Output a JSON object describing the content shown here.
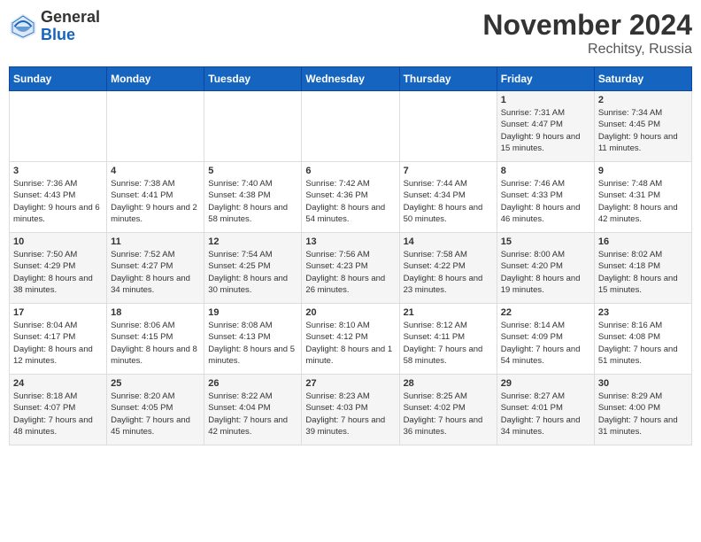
{
  "header": {
    "logo": {
      "general": "General",
      "blue": "Blue"
    },
    "title": "November 2024",
    "location": "Rechitsy, Russia"
  },
  "weekdays": [
    "Sunday",
    "Monday",
    "Tuesday",
    "Wednesday",
    "Thursday",
    "Friday",
    "Saturday"
  ],
  "weeks": [
    [
      null,
      null,
      null,
      null,
      null,
      {
        "day": "1",
        "sunrise": "Sunrise: 7:31 AM",
        "sunset": "Sunset: 4:47 PM",
        "daylight": "Daylight: 9 hours and 15 minutes."
      },
      {
        "day": "2",
        "sunrise": "Sunrise: 7:34 AM",
        "sunset": "Sunset: 4:45 PM",
        "daylight": "Daylight: 9 hours and 11 minutes."
      }
    ],
    [
      {
        "day": "3",
        "sunrise": "Sunrise: 7:36 AM",
        "sunset": "Sunset: 4:43 PM",
        "daylight": "Daylight: 9 hours and 6 minutes."
      },
      {
        "day": "4",
        "sunrise": "Sunrise: 7:38 AM",
        "sunset": "Sunset: 4:41 PM",
        "daylight": "Daylight: 9 hours and 2 minutes."
      },
      {
        "day": "5",
        "sunrise": "Sunrise: 7:40 AM",
        "sunset": "Sunset: 4:38 PM",
        "daylight": "Daylight: 8 hours and 58 minutes."
      },
      {
        "day": "6",
        "sunrise": "Sunrise: 7:42 AM",
        "sunset": "Sunset: 4:36 PM",
        "daylight": "Daylight: 8 hours and 54 minutes."
      },
      {
        "day": "7",
        "sunrise": "Sunrise: 7:44 AM",
        "sunset": "Sunset: 4:34 PM",
        "daylight": "Daylight: 8 hours and 50 minutes."
      },
      {
        "day": "8",
        "sunrise": "Sunrise: 7:46 AM",
        "sunset": "Sunset: 4:33 PM",
        "daylight": "Daylight: 8 hours and 46 minutes."
      },
      {
        "day": "9",
        "sunrise": "Sunrise: 7:48 AM",
        "sunset": "Sunset: 4:31 PM",
        "daylight": "Daylight: 8 hours and 42 minutes."
      }
    ],
    [
      {
        "day": "10",
        "sunrise": "Sunrise: 7:50 AM",
        "sunset": "Sunset: 4:29 PM",
        "daylight": "Daylight: 8 hours and 38 minutes."
      },
      {
        "day": "11",
        "sunrise": "Sunrise: 7:52 AM",
        "sunset": "Sunset: 4:27 PM",
        "daylight": "Daylight: 8 hours and 34 minutes."
      },
      {
        "day": "12",
        "sunrise": "Sunrise: 7:54 AM",
        "sunset": "Sunset: 4:25 PM",
        "daylight": "Daylight: 8 hours and 30 minutes."
      },
      {
        "day": "13",
        "sunrise": "Sunrise: 7:56 AM",
        "sunset": "Sunset: 4:23 PM",
        "daylight": "Daylight: 8 hours and 26 minutes."
      },
      {
        "day": "14",
        "sunrise": "Sunrise: 7:58 AM",
        "sunset": "Sunset: 4:22 PM",
        "daylight": "Daylight: 8 hours and 23 minutes."
      },
      {
        "day": "15",
        "sunrise": "Sunrise: 8:00 AM",
        "sunset": "Sunset: 4:20 PM",
        "daylight": "Daylight: 8 hours and 19 minutes."
      },
      {
        "day": "16",
        "sunrise": "Sunrise: 8:02 AM",
        "sunset": "Sunset: 4:18 PM",
        "daylight": "Daylight: 8 hours and 15 minutes."
      }
    ],
    [
      {
        "day": "17",
        "sunrise": "Sunrise: 8:04 AM",
        "sunset": "Sunset: 4:17 PM",
        "daylight": "Daylight: 8 hours and 12 minutes."
      },
      {
        "day": "18",
        "sunrise": "Sunrise: 8:06 AM",
        "sunset": "Sunset: 4:15 PM",
        "daylight": "Daylight: 8 hours and 8 minutes."
      },
      {
        "day": "19",
        "sunrise": "Sunrise: 8:08 AM",
        "sunset": "Sunset: 4:13 PM",
        "daylight": "Daylight: 8 hours and 5 minutes."
      },
      {
        "day": "20",
        "sunrise": "Sunrise: 8:10 AM",
        "sunset": "Sunset: 4:12 PM",
        "daylight": "Daylight: 8 hours and 1 minute."
      },
      {
        "day": "21",
        "sunrise": "Sunrise: 8:12 AM",
        "sunset": "Sunset: 4:11 PM",
        "daylight": "Daylight: 7 hours and 58 minutes."
      },
      {
        "day": "22",
        "sunrise": "Sunrise: 8:14 AM",
        "sunset": "Sunset: 4:09 PM",
        "daylight": "Daylight: 7 hours and 54 minutes."
      },
      {
        "day": "23",
        "sunrise": "Sunrise: 8:16 AM",
        "sunset": "Sunset: 4:08 PM",
        "daylight": "Daylight: 7 hours and 51 minutes."
      }
    ],
    [
      {
        "day": "24",
        "sunrise": "Sunrise: 8:18 AM",
        "sunset": "Sunset: 4:07 PM",
        "daylight": "Daylight: 7 hours and 48 minutes."
      },
      {
        "day": "25",
        "sunrise": "Sunrise: 8:20 AM",
        "sunset": "Sunset: 4:05 PM",
        "daylight": "Daylight: 7 hours and 45 minutes."
      },
      {
        "day": "26",
        "sunrise": "Sunrise: 8:22 AM",
        "sunset": "Sunset: 4:04 PM",
        "daylight": "Daylight: 7 hours and 42 minutes."
      },
      {
        "day": "27",
        "sunrise": "Sunrise: 8:23 AM",
        "sunset": "Sunset: 4:03 PM",
        "daylight": "Daylight: 7 hours and 39 minutes."
      },
      {
        "day": "28",
        "sunrise": "Sunrise: 8:25 AM",
        "sunset": "Sunset: 4:02 PM",
        "daylight": "Daylight: 7 hours and 36 minutes."
      },
      {
        "day": "29",
        "sunrise": "Sunrise: 8:27 AM",
        "sunset": "Sunset: 4:01 PM",
        "daylight": "Daylight: 7 hours and 34 minutes."
      },
      {
        "day": "30",
        "sunrise": "Sunrise: 8:29 AM",
        "sunset": "Sunset: 4:00 PM",
        "daylight": "Daylight: 7 hours and 31 minutes."
      }
    ]
  ]
}
